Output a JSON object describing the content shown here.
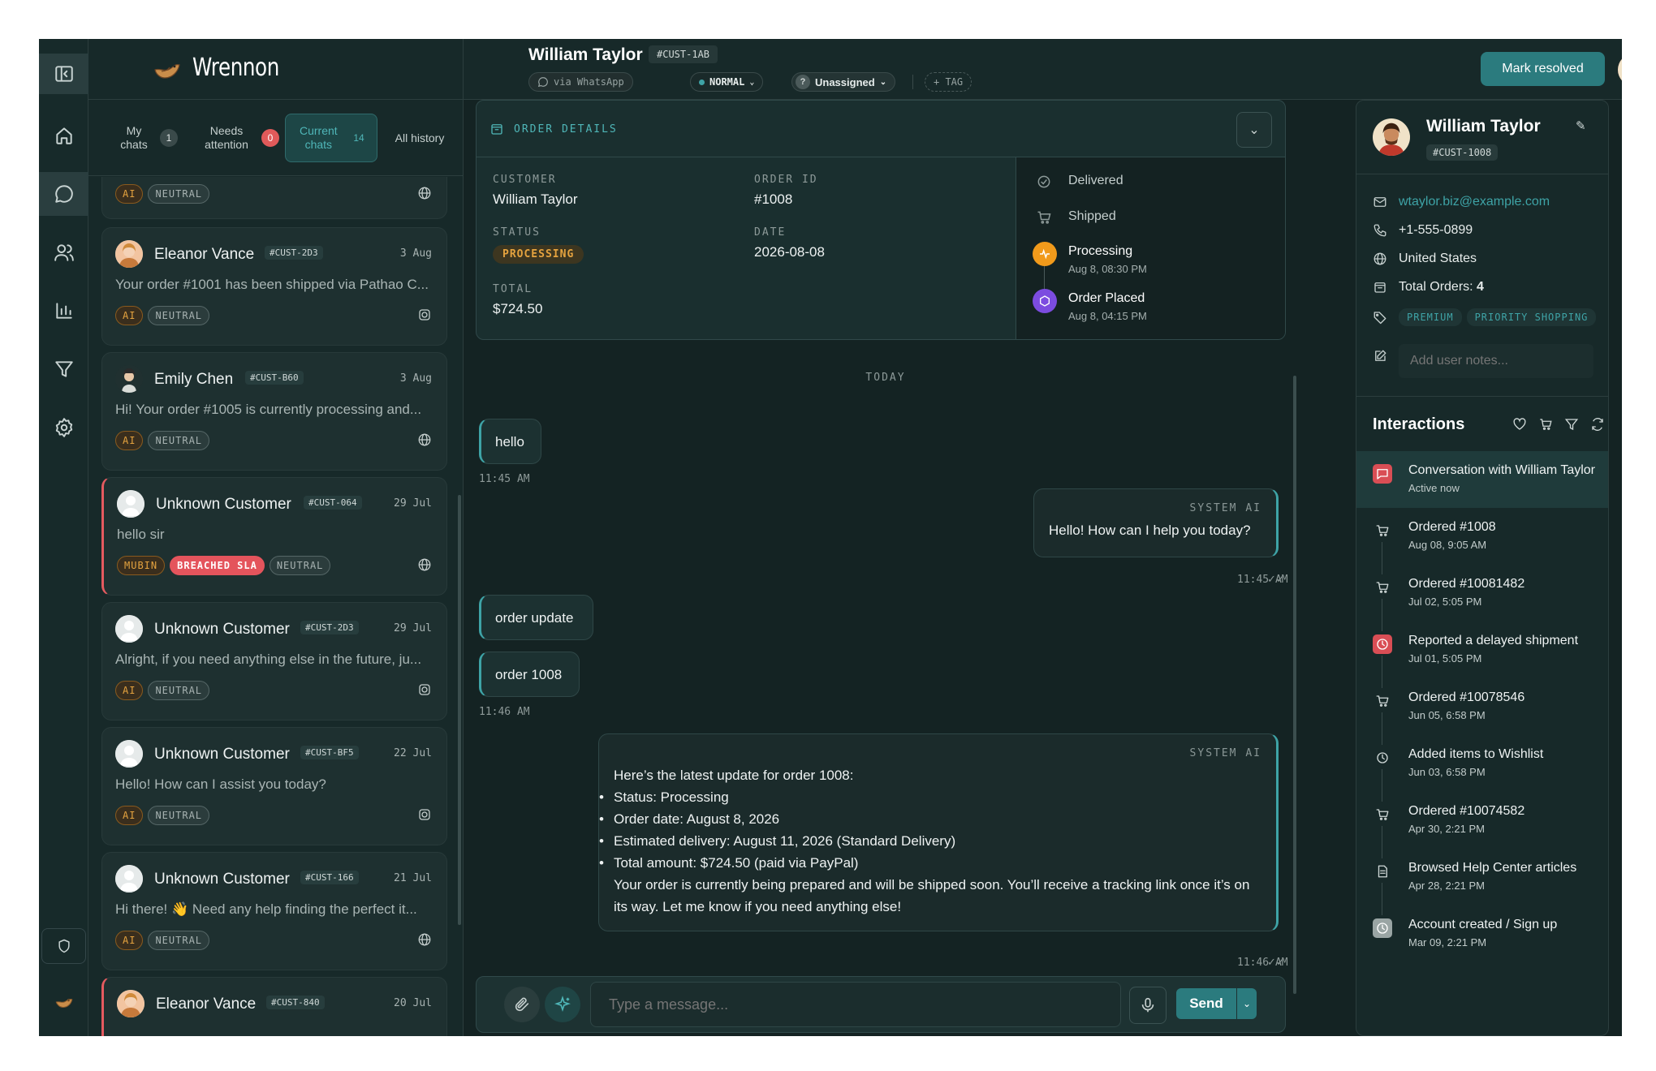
{
  "brand": {
    "name": "Wrennon"
  },
  "tabs": [
    {
      "label": "My chats",
      "count": "1"
    },
    {
      "label": "Needs attention",
      "count": "0"
    },
    {
      "label": "Current chats",
      "count": "14"
    },
    {
      "label": "All history",
      "count": ""
    }
  ],
  "conversations": [
    {
      "name": "",
      "id": "",
      "date": "",
      "preview": "",
      "tags": [
        "AI",
        "NEUTRAL"
      ],
      "channel": "globe-icon"
    },
    {
      "name": "Eleanor Vance",
      "id": "#CUST-2D3",
      "date": "3 Aug",
      "preview": "Your order #1001 has been shipped via Pathao C...",
      "tags": [
        "AI",
        "NEUTRAL"
      ],
      "channel": "instagram-icon"
    },
    {
      "name": "Emily Chen",
      "id": "#CUST-B60",
      "date": "3 Aug",
      "preview": "Hi! Your order #1005 is currently processing and...",
      "tags": [
        "AI",
        "NEUTRAL"
      ],
      "channel": "globe-icon"
    },
    {
      "name": "Unknown Customer",
      "id": "#CUST-064",
      "date": "29 Jul",
      "preview": "hello sir",
      "tags": [
        "MUBIN",
        "BREACHED SLA",
        "NEUTRAL"
      ],
      "channel": "globe-icon"
    },
    {
      "name": "Unknown Customer",
      "id": "#CUST-2D3",
      "date": "29 Jul",
      "preview": "Alright, if you need anything else in the future, ju...",
      "tags": [
        "AI",
        "NEUTRAL"
      ],
      "channel": "instagram-icon"
    },
    {
      "name": "Unknown Customer",
      "id": "#CUST-BF5",
      "date": "22 Jul",
      "preview": "Hello! How can I assist you today?",
      "tags": [
        "AI",
        "NEUTRAL"
      ],
      "channel": "instagram-icon"
    },
    {
      "name": "Unknown Customer",
      "id": "#CUST-166",
      "date": "21 Jul",
      "preview": "Hi there! 👋 Need any help finding the perfect it...",
      "tags": [
        "AI",
        "NEUTRAL"
      ],
      "channel": "globe-icon"
    },
    {
      "name": "Eleanor Vance",
      "id": "#CUST-840",
      "date": "20 Jul",
      "preview": "",
      "tags": [],
      "channel": ""
    }
  ],
  "header": {
    "name": "William Taylor",
    "id": "#CUST-1AB",
    "channel": "via WhatsApp",
    "priority": "NORMAL",
    "assignee": "Unassigned",
    "tag": "+ TAG",
    "resolve": "Mark resolved"
  },
  "order": {
    "title": "ORDER DETAILS",
    "customer_label": "CUSTOMER",
    "customer": "William Taylor",
    "orderid_label": "ORDER ID",
    "orderid": "#1008",
    "status_label": "STATUS",
    "status": "PROCESSING",
    "date_label": "DATE",
    "date": "2026-08-08",
    "total_label": "TOTAL",
    "total": "$724.50",
    "timeline": [
      {
        "label": "Delivered",
        "time": ""
      },
      {
        "label": "Shipped",
        "time": ""
      },
      {
        "label": "Processing",
        "time": "Aug 8, 08:30 PM"
      },
      {
        "label": "Order Placed",
        "time": "Aug 8, 04:15 PM"
      }
    ]
  },
  "messages": {
    "day": "TODAY",
    "m1": "hello",
    "t1": "11:45 AM",
    "sys1_label": "SYSTEM AI",
    "sys1": "Hello! How can I help you today?",
    "t2": "11:45 AM",
    "m2": "order update",
    "m3": "order 1008",
    "t3": "11:46 AM",
    "sys2_label": "SYSTEM AI",
    "sys2_intro": "Here’s the latest update for order 1008:",
    "sys2_items": [
      "Status: Processing",
      "Order date: August 8, 2026",
      "Estimated delivery: August 11, 2026 (Standard Delivery)",
      "Total amount: $724.50 (paid via PayPal)"
    ],
    "sys2_outro": "Your order is currently being prepared and will be shipped soon. You’ll receive a tracking link once it’s on its way. Let me know if you need anything else!",
    "t4": "11:46 AM"
  },
  "composer": {
    "placeholder": "Type a message...",
    "send": "Send"
  },
  "profile": {
    "name": "William Taylor",
    "id": "#CUST-1008",
    "email": "wtaylor.biz@example.com",
    "phone": "+1-555-0899",
    "country": "United States",
    "orders_label": "Total Orders:",
    "orders": "4",
    "tags": [
      "PREMIUM",
      "PRIORITY SHOPPING"
    ],
    "notes_placeholder": "Add user notes..."
  },
  "interactions": {
    "title": "Interactions",
    "items": [
      {
        "title": "Conversation with William Taylor",
        "sub": "Active now",
        "icon": "chat-icon"
      },
      {
        "title": "Ordered #1008",
        "sub": "Aug 08, 9:05 AM",
        "icon": "cart-icon"
      },
      {
        "title": "Ordered #10081482",
        "sub": "Jul 02, 5:05 PM",
        "icon": "cart-icon"
      },
      {
        "title": "Reported a delayed shipment",
        "sub": "Jul 01, 5:05 PM",
        "icon": "alert-clock-icon"
      },
      {
        "title": "Ordered #10078546",
        "sub": "Jun 05, 6:58 PM",
        "icon": "cart-icon"
      },
      {
        "title": "Added items to Wishlist",
        "sub": "Jun 03, 6:58 PM",
        "icon": "clock-icon"
      },
      {
        "title": "Ordered #10074582",
        "sub": "Apr 30, 2:21 PM",
        "icon": "cart-icon"
      },
      {
        "title": "Browsed Help Center articles",
        "sub": "Apr 28, 2:21 PM",
        "icon": "document-icon"
      },
      {
        "title": "Account created / Sign up",
        "sub": "Mar 09, 2:21 PM",
        "icon": "clock-icon"
      }
    ]
  },
  "colors": {
    "accent": "#2b7b7e",
    "teal": "#3ea3a6",
    "danger": "#e4545c",
    "ai": "#e5a33f",
    "bg": "#142323"
  }
}
